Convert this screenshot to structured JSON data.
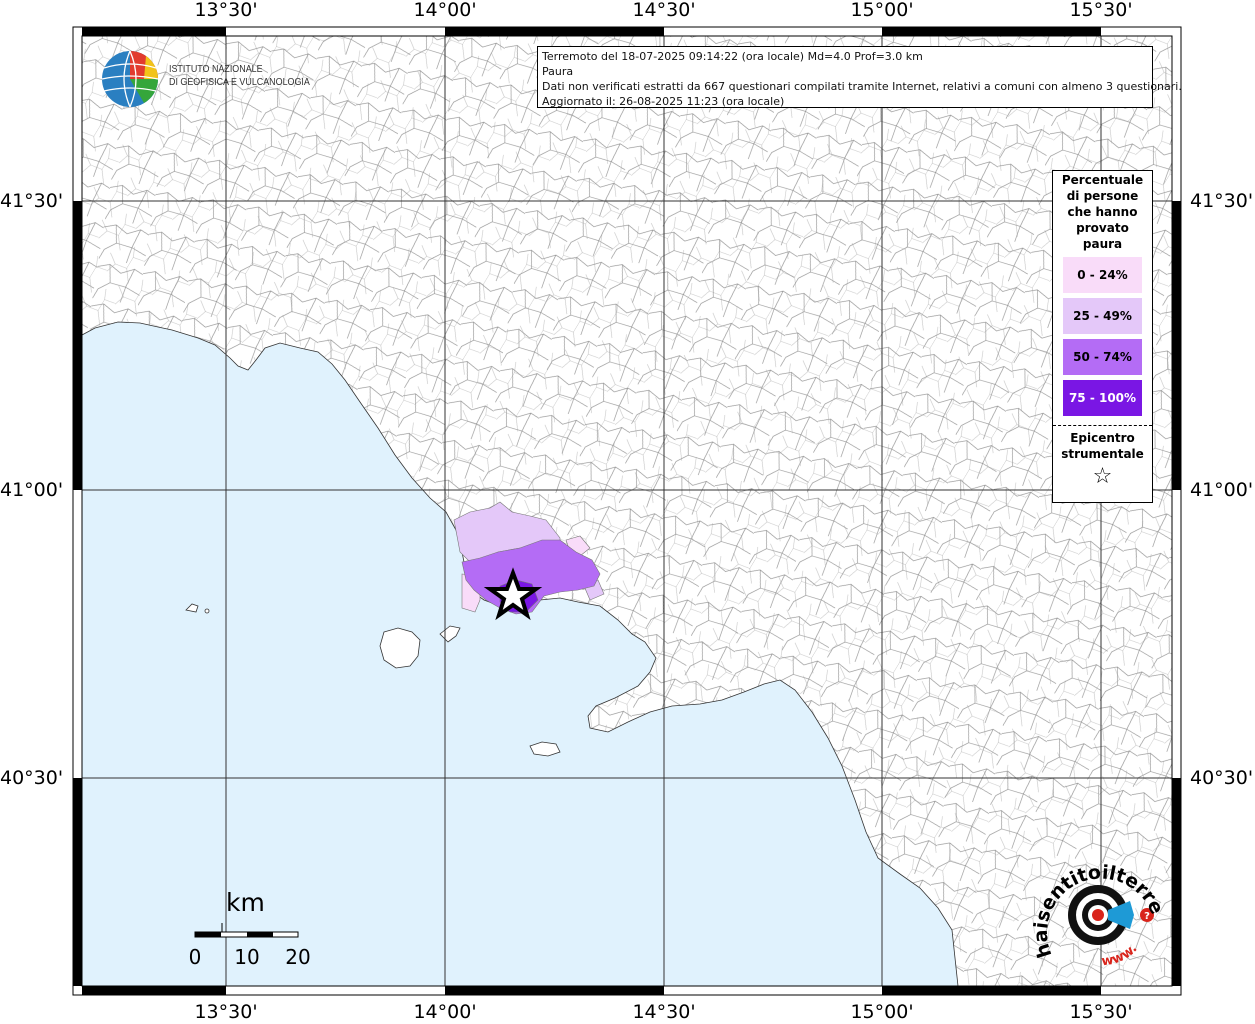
{
  "axes": {
    "lon_ticks": [
      "13°30'",
      "14°00'",
      "14°30'",
      "15°00'",
      "15°30'"
    ],
    "lat_ticks": [
      "41°30'",
      "41°00'",
      "40°30'"
    ]
  },
  "institute": {
    "line1": "ISTITUTO NAZIONALE",
    "line2": "DI GEOFISICA E VULCANOLOGIA"
  },
  "info": {
    "line1": "Terremoto del 18-07-2025 09:14:22 (ora locale) Md=4.0 Prof=3.0 km",
    "line2": "Paura",
    "line3": "Dati non verificati estratti da 667 questionari compilati tramite Internet, relativi a comuni con almeno 3 questionari.",
    "line4": "Aggiornato il: 26-08-2025 11:23 (ora locale)"
  },
  "legend": {
    "title_lines": [
      "Percentuale",
      "di persone",
      "che hanno",
      "provato",
      "paura"
    ],
    "classes": [
      {
        "label": "0 - 24%",
        "color": "#f9dcf9",
        "text_color": "#000000"
      },
      {
        "label": "25 - 49%",
        "color": "#e4c8f9",
        "text_color": "#000000"
      },
      {
        "label": "50 - 74%",
        "color": "#b46cf5",
        "text_color": "#000000"
      },
      {
        "label": "75 - 100%",
        "color": "#7a16e4",
        "text_color": "#ffffff"
      }
    ],
    "epicenter_lines": [
      "Epicentro",
      "strumentale"
    ],
    "epicenter_symbol": "☆"
  },
  "scalebar": {
    "unit": "km",
    "labels": [
      "0",
      "10",
      "20"
    ]
  },
  "colors": {
    "sea": "#e0f2fd",
    "land": "#ffffff",
    "grid": "#333333"
  },
  "hsl_logo": {
    "arc_text": "haisentitoilterremoto.it",
    "bottom_text": "www.",
    "question": "?"
  }
}
